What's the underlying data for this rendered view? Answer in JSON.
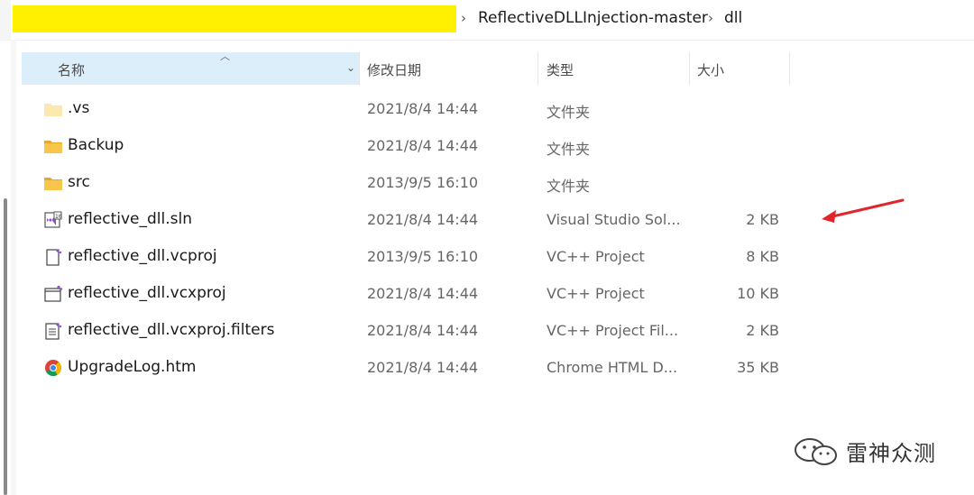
{
  "breadcrumb": {
    "separator": "›",
    "items": [
      "ReflectiveDLLInjection-master",
      "dll"
    ]
  },
  "columns": {
    "name": "名称",
    "date": "修改日期",
    "type": "类型",
    "size": "大小"
  },
  "files": [
    {
      "name": ".vs",
      "date": "2021/8/4 14:44",
      "type": "文件夹",
      "size": "",
      "icon": "folder-icon"
    },
    {
      "name": "Backup",
      "date": "2021/8/4 14:44",
      "type": "文件夹",
      "size": "",
      "icon": "folder-icon"
    },
    {
      "name": "src",
      "date": "2013/9/5 16:10",
      "type": "文件夹",
      "size": "",
      "icon": "folder-icon"
    },
    {
      "name": "reflective_dll.sln",
      "date": "2021/8/4 14:44",
      "type": "Visual Studio Sol...",
      "size": "2 KB",
      "icon": "visual-studio-solution-icon"
    },
    {
      "name": "reflective_dll.vcproj",
      "date": "2013/9/5 16:10",
      "type": "VC++ Project",
      "size": "8 KB",
      "icon": "vc-project-file-icon"
    },
    {
      "name": "reflective_dll.vcxproj",
      "date": "2021/8/4 14:44",
      "type": "VC++ Project",
      "size": "10 KB",
      "icon": "vc-project-window-icon"
    },
    {
      "name": "reflective_dll.vcxproj.filters",
      "date": "2021/8/4 14:44",
      "type": "VC++ Project Fil...",
      "size": "2 KB",
      "icon": "vc-filters-file-icon"
    },
    {
      "name": "UpgradeLog.htm",
      "date": "2021/8/4 14:44",
      "type": "Chrome HTML D...",
      "size": "35 KB",
      "icon": "chrome-icon"
    }
  ],
  "watermark": {
    "text": "雷神众测",
    "icon": "wechat-icon"
  },
  "colors": {
    "header_selected": "#ddeefb",
    "folder": "#f8c64a",
    "arrow": "#e0262b",
    "redaction": "#ffef00"
  }
}
